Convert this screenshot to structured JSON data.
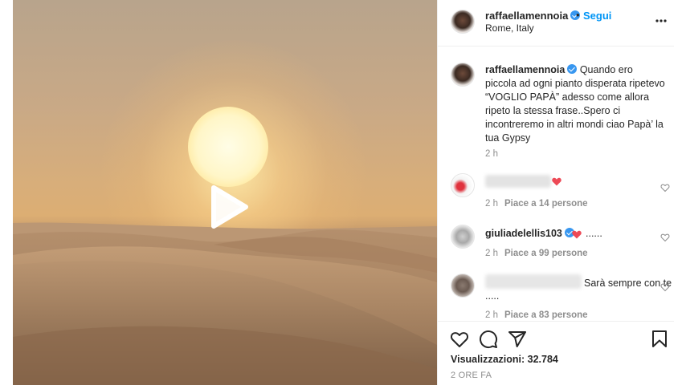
{
  "post": {
    "author": "raffaellamennoia",
    "follow_label": "Segui",
    "separator": "•",
    "location": "Rome, Italy",
    "more_icon": "more-horizontal-icon"
  },
  "caption": {
    "author": "raffaellamennoia",
    "text": "Quando ero piccola ad ogni pianto disperata ripetevo “VOGLIO PAPÀ” adesso come allora ripeto la stessa frase..Spero ci incontreremo in altri mondi ciao Papà’ la tua Gypsy",
    "time": "2 h"
  },
  "comments": [
    {
      "user": "",
      "text": "",
      "time": "2 h",
      "likes": "Piace a 14 persone"
    },
    {
      "user": "giuliadelellis103",
      "text": "......",
      "time": "2 h",
      "likes": "Piace a 99 persone"
    },
    {
      "user": "",
      "text": "Sarà sempre con te",
      "text2": ".....",
      "time": "2 h",
      "likes": "Piace a 83 persone"
    }
  ],
  "footer": {
    "views": "Visualizzazioni: 32.784",
    "time_ago": "2 ORE FA"
  },
  "icons": [
    "play-icon",
    "heart-icon",
    "comment-icon",
    "share-icon",
    "bookmark-icon",
    "verified-icon"
  ],
  "colors": {
    "link": "#0095f6",
    "verified": "#3897f0",
    "heart": "#ed4956",
    "muted": "#8e8e8e"
  }
}
